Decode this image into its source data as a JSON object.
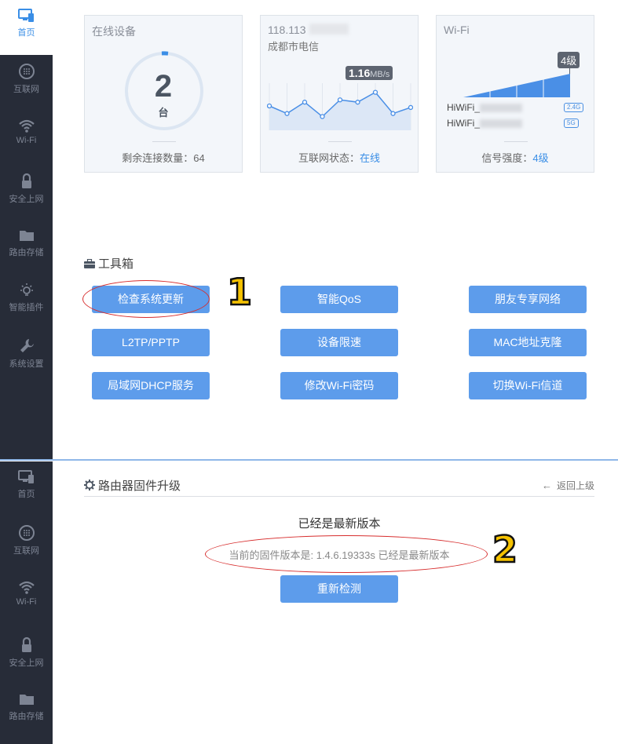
{
  "sidebar_top": [
    {
      "label": "首页",
      "icon": "monitor-icon",
      "active": true
    },
    {
      "label": "互联网",
      "icon": "globe-icon"
    },
    {
      "label": "Wi-Fi",
      "icon": "wifi-icon"
    },
    {
      "label": "安全上网",
      "icon": "lock-icon"
    },
    {
      "label": "路由存储",
      "icon": "folder-icon"
    },
    {
      "label": "智能插件",
      "icon": "bulb-icon"
    },
    {
      "label": "系统设置",
      "icon": "wrench-icon"
    }
  ],
  "sidebar_bottom": [
    {
      "label": "首页",
      "icon": "monitor-icon"
    },
    {
      "label": "互联网",
      "icon": "globe-icon"
    },
    {
      "label": "Wi-Fi",
      "icon": "wifi-icon"
    },
    {
      "label": "安全上网",
      "icon": "lock-icon"
    },
    {
      "label": "路由存储",
      "icon": "folder-icon"
    }
  ],
  "devices_card": {
    "title": "在线设备",
    "count": "2",
    "unit": "台",
    "footer_label": "剩余连接数量：",
    "footer_value": "64"
  },
  "internet_card": {
    "ip": "118.113",
    "isp": "成都市电信",
    "speed_value": "1.16",
    "speed_unit": "MB/s",
    "footer_label": "互联网状态：",
    "footer_value": "在线",
    "series": [
      30,
      20,
      35,
      16,
      38,
      35,
      48,
      20,
      28
    ]
  },
  "wifi_card": {
    "title": "Wi-Fi",
    "level": "4级",
    "ssid_1": "HiWiFi_",
    "ssid_2": "HiWiFi_",
    "band_1": "2.4G",
    "band_2": "5G",
    "footer_label": "信号强度：",
    "footer_value": "4级"
  },
  "toolbox": {
    "title": "工具箱",
    "buttons": [
      "检查系统更新",
      "智能QoS",
      "朋友专享网络",
      "L2TP/PPTP",
      "设备限速",
      "MAC地址克隆",
      "局域网DHCP服务",
      "修改Wi-Fi密码",
      "切换Wi-Fi信道"
    ]
  },
  "firmware": {
    "title": "路由器固件升级",
    "back_label": "返回上级",
    "status": "已经是最新版本",
    "version_text": "当前的固件版本是: 1.4.6.19333s 已经是最新版本",
    "recheck_button": "重新检测"
  },
  "annotations": {
    "one": "1",
    "two": "2"
  },
  "colors": {
    "accent": "#5d9ceb",
    "sidebar": "#272c38",
    "highlight": "#d72d2d"
  }
}
